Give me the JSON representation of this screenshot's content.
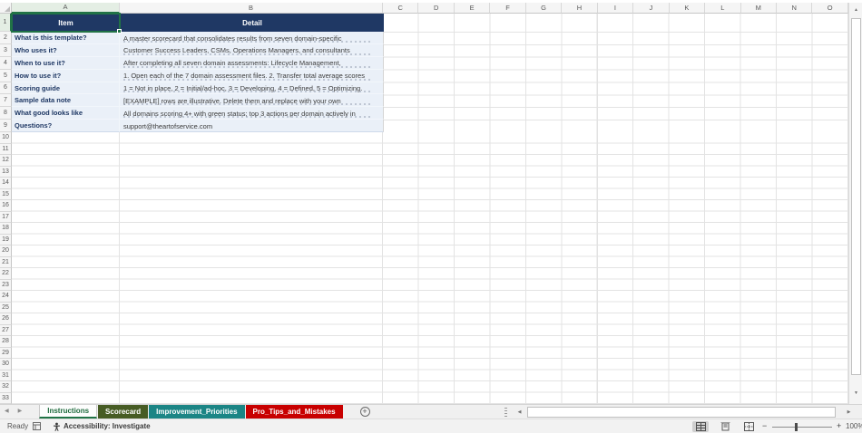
{
  "grid": {
    "columns": [
      "A",
      "B",
      "C",
      "D",
      "E",
      "F",
      "G",
      "H",
      "I",
      "J",
      "K",
      "L",
      "M",
      "N",
      "O"
    ],
    "row_count": 33,
    "active_cell": "A1"
  },
  "table": {
    "headers": {
      "item": "Item",
      "detail": "Detail"
    },
    "rows": [
      {
        "item": "What is this template?",
        "detail": "A master scorecard that consolidates results from seven domain-specific",
        "wrapped": true
      },
      {
        "item": "Who uses it?",
        "detail": "Customer Success Leaders, CSMs, Operations Managers, and consultants",
        "wrapped": true
      },
      {
        "item": "When to use it?",
        "detail": "After completing all seven domain assessments: Lifecycle Management,",
        "wrapped": true
      },
      {
        "item": "How to use it?",
        "detail": "1. Open each of the 7 domain assessment files. 2. Transfer total average scores",
        "wrapped": true
      },
      {
        "item": "Scoring guide",
        "detail": "1 = Not in place, 2 = Initial/ad-hoc, 3 = Developing, 4 = Defined, 5 = Optimizing.",
        "wrapped": true
      },
      {
        "item": "Sample data note",
        "detail": "[EXAMPLE] rows are illustrative. Delete them and replace with your own",
        "wrapped": true
      },
      {
        "item": "What good looks like",
        "detail": "All domains scoring 4+ with green status; top 3 actions per domain actively in",
        "wrapped": true
      },
      {
        "item": "Questions?",
        "detail": "support@theartofservice.com",
        "wrapped": false
      }
    ]
  },
  "sheet_tabs": [
    {
      "label": "Instructions",
      "active": true,
      "color": "#fdfdfd"
    },
    {
      "label": "Scorecard",
      "active": false,
      "color": "#475c24"
    },
    {
      "label": "Improvement_Priorities",
      "active": false,
      "color": "#1b8585"
    },
    {
      "label": "Pro_Tips_and_Mistakes",
      "active": false,
      "color": "#c80000"
    }
  ],
  "status_bar": {
    "ready": "Ready",
    "accessibility": "Accessibility: Investigate",
    "zoom": "100%"
  },
  "icons": {
    "new_sheet": "+",
    "nav_left": "◀",
    "nav_right": "▶",
    "scroll_up": "▲",
    "scroll_down": "▼",
    "scroll_left": "◀",
    "scroll_right": "▶",
    "zoom_out": "−",
    "zoom_in": "+"
  },
  "colors": {
    "header_fill": "#1f3864",
    "row_fill": "#eaf0f8",
    "item_text": "#1f3864",
    "selection": "#217346"
  }
}
